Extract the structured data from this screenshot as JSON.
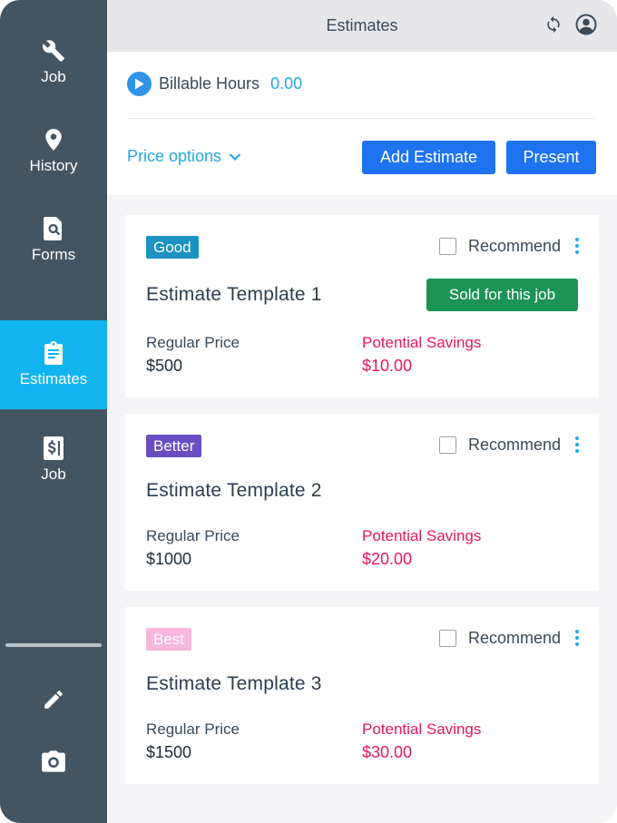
{
  "sidebar": {
    "items": [
      {
        "label": "Job",
        "icon": "wrench-icon"
      },
      {
        "label": "History",
        "icon": "location-pin-icon"
      },
      {
        "label": "Forms",
        "icon": "document-search-icon"
      },
      {
        "label": "Estimates",
        "icon": "clipboard-icon",
        "active": true
      },
      {
        "label": "Job",
        "icon": "invoice-dollar-icon"
      }
    ],
    "tools": [
      "pencil-icon",
      "camera-icon"
    ]
  },
  "topbar": {
    "title": "Estimates",
    "icons": [
      "sync-icon",
      "user-account-icon"
    ]
  },
  "header": {
    "billable_label": "Billable Hours",
    "billable_value": "0.00",
    "price_options": "Price options",
    "add_estimate": "Add Estimate",
    "present": "Present"
  },
  "estimates": [
    {
      "tier": "Good",
      "tier_color": "#1c92c4",
      "title": "Estimate Template 1",
      "recommend_label": "Recommend",
      "sold_label": "Sold for this job",
      "regular_label": "Regular Price",
      "regular_value": "$500",
      "savings_label": "Potential Savings",
      "savings_value": "$10.00"
    },
    {
      "tier": "Better",
      "tier_color": "#6a4fc4",
      "title": "Estimate Template 2",
      "recommend_label": "Recommend",
      "regular_label": "Regular Price",
      "regular_value": "$1000",
      "savings_label": "Potential Savings",
      "savings_value": "$20.00"
    },
    {
      "tier": "Best",
      "tier_color": "#f7b8dc",
      "title": "Estimate Template 3",
      "recommend_label": "Recommend",
      "regular_label": "Regular Price",
      "regular_value": "$1500",
      "savings_label": "Potential Savings",
      "savings_value": "$30.00"
    }
  ],
  "colors": {
    "sidebar": "#435563",
    "active_nav": "#12b4f0",
    "primary_button": "#1e73f0",
    "link": "#21a9e6",
    "sold_button": "#1c9455",
    "savings": "#e8175d"
  }
}
